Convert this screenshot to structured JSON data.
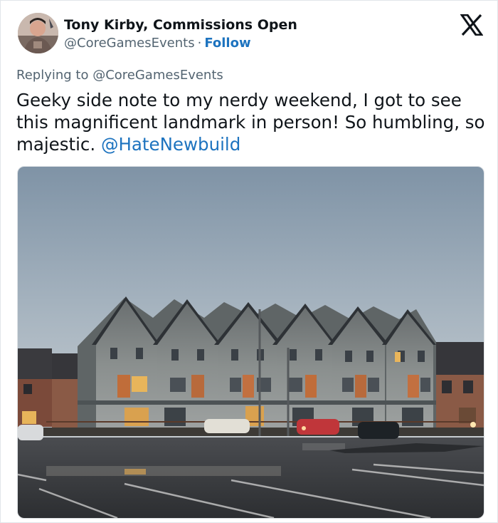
{
  "author": {
    "display_name": "Tony Kirby, Commissions Open",
    "handle": "@CoreGamesEvents",
    "separator": "·",
    "follow_label": "Follow"
  },
  "tweet": {
    "replying_prefix": "Replying to ",
    "replying_to": "@CoreGamesEvents",
    "text": "Geeky side note to my nerdy weekend, I got to see this magnificent landmark in person! So humbling, so majestic. ",
    "mention": "@HateNewbuild"
  },
  "icons": {
    "x_logo": "x-logo-icon",
    "avatar": "avatar"
  },
  "colors": {
    "link": "#1d73bf",
    "secondary_text": "#536471",
    "primary_text": "#0f1419"
  }
}
